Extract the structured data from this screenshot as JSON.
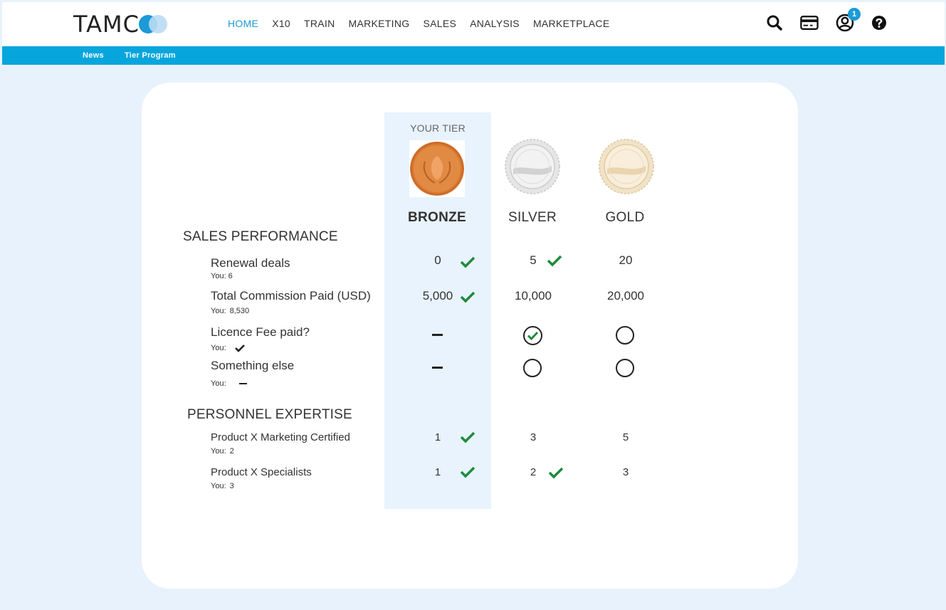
{
  "header": {
    "logo_text": "TAMC",
    "nav": [
      {
        "label": "HOME",
        "active": true
      },
      {
        "label": "X10"
      },
      {
        "label": "TRAIN"
      },
      {
        "label": "MARKETING"
      },
      {
        "label": "SALES"
      },
      {
        "label": "ANALYSIS"
      },
      {
        "label": "MARKETPLACE"
      }
    ],
    "icons": [
      "search-icon",
      "credit-card-icon",
      "user-account-icon",
      "help-icon"
    ],
    "notification_count": "1"
  },
  "subnav": [
    {
      "label": "News"
    },
    {
      "label": "Tier Program"
    }
  ],
  "tiers": {
    "your_tier_label": "YOUR TIER",
    "columns": [
      {
        "name": "BRONZE",
        "current": true
      },
      {
        "name": "SILVER"
      },
      {
        "name": "GOLD"
      }
    ]
  },
  "sections": {
    "sales_performance": {
      "title": "SALES PERFORMANCE",
      "rows": [
        {
          "label": "Renewal deals",
          "you_label": "You:",
          "you_value": "6",
          "bronze": "0",
          "silver": "5",
          "gold": "20",
          "met": [
            true,
            true,
            false
          ]
        },
        {
          "label": "Total Commission Paid (USD)",
          "you_label": "You:",
          "you_value": "8,530",
          "bronze": "5,000",
          "silver": "10,000",
          "gold": "20,000",
          "met": [
            true,
            false,
            false
          ]
        },
        {
          "label": "Licence Fee paid?",
          "you_label": "You:",
          "you_value": "check",
          "bronze": "dash",
          "silver": "circle-checked",
          "gold": "circle-empty"
        },
        {
          "label": "Something else",
          "you_label": "You:",
          "you_value": "dash",
          "bronze": "dash",
          "silver": "circle-empty",
          "gold": "circle-empty"
        }
      ]
    },
    "personnel_expertise": {
      "title": "PERSONNEL EXPERTISE",
      "rows": [
        {
          "label": "Product X Marketing Certified",
          "you_label": "You:",
          "you_value": "2",
          "bronze": "1",
          "silver": "3",
          "gold": "5",
          "met": [
            true,
            false,
            false
          ]
        },
        {
          "label": "Product X Specialists",
          "you_label": "You:",
          "you_value": "3",
          "bronze": "1",
          "silver": "2",
          "gold": "3",
          "met": [
            true,
            true,
            false
          ]
        }
      ]
    }
  },
  "colors": {
    "accent": "#1b9ad6",
    "subbar": "#06a6dd",
    "page_bg": "#e8f2fc",
    "tier_highlight": "#e8f3fd",
    "check_green": "#1f8a3c",
    "bronze": "#d9782f",
    "silver": "#d8d8d8",
    "gold": "#ecd9b8"
  }
}
